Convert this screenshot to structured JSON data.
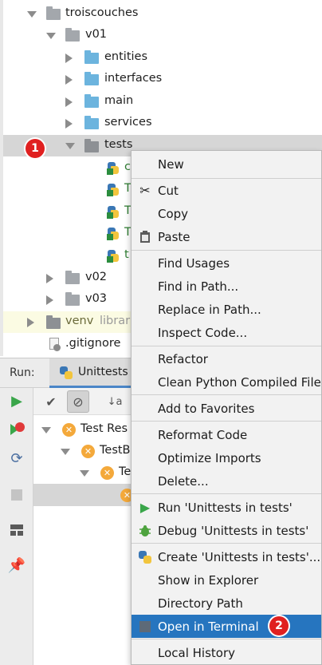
{
  "tree": {
    "root": "troiscouches",
    "v01": "v01",
    "children": [
      "entities",
      "interfaces",
      "main",
      "services",
      "tests"
    ],
    "test_files": [
      "c",
      "T",
      "T",
      "T",
      "t"
    ],
    "v02": "v02",
    "v03": "v03",
    "venv": "venv",
    "venv_hint": "librar",
    "gitignore": ".gitignore"
  },
  "badges": {
    "one": "1",
    "two": "2"
  },
  "run": {
    "title": "Run:",
    "tab_label": "Unittests",
    "results": [
      {
        "label": "Test Res"
      },
      {
        "label": "TestB"
      },
      {
        "label": "Te"
      }
    ]
  },
  "menu": {
    "items": [
      {
        "label": "New",
        "icon": ""
      },
      {
        "label": "Cut",
        "icon": "scissors-icon"
      },
      {
        "label": "Copy",
        "icon": ""
      },
      {
        "label": "Paste",
        "icon": "clipboard-icon"
      },
      {
        "label": "Find Usages",
        "icon": ""
      },
      {
        "label": "Find in Path...",
        "icon": ""
      },
      {
        "label": "Replace in Path...",
        "icon": ""
      },
      {
        "label": "Inspect Code...",
        "icon": ""
      },
      {
        "label": "Refactor",
        "icon": ""
      },
      {
        "label": "Clean Python Compiled Files",
        "icon": ""
      },
      {
        "label": "Add to Favorites",
        "icon": ""
      },
      {
        "label": "Reformat Code",
        "icon": ""
      },
      {
        "label": "Optimize Imports",
        "icon": ""
      },
      {
        "label": "Delete...",
        "icon": ""
      },
      {
        "label": "Run 'Unittests in tests'",
        "icon": "run-icon"
      },
      {
        "label": "Debug 'Unittests in tests'",
        "icon": "debug-icon"
      },
      {
        "label": "Create 'Unittests in tests'...",
        "icon": "python-icon"
      },
      {
        "label": "Show in Explorer",
        "icon": ""
      },
      {
        "label": "Directory Path",
        "icon": ""
      },
      {
        "label": "Open in Terminal",
        "icon": "terminal-icon"
      },
      {
        "label": "Local History",
        "icon": ""
      }
    ]
  },
  "colors": {
    "highlight": "#2675bf",
    "badge": "#e02020",
    "folder_blue": "#6cb4de",
    "folder_gray": "#a3a7ac",
    "test_error": "#f4a93b"
  }
}
